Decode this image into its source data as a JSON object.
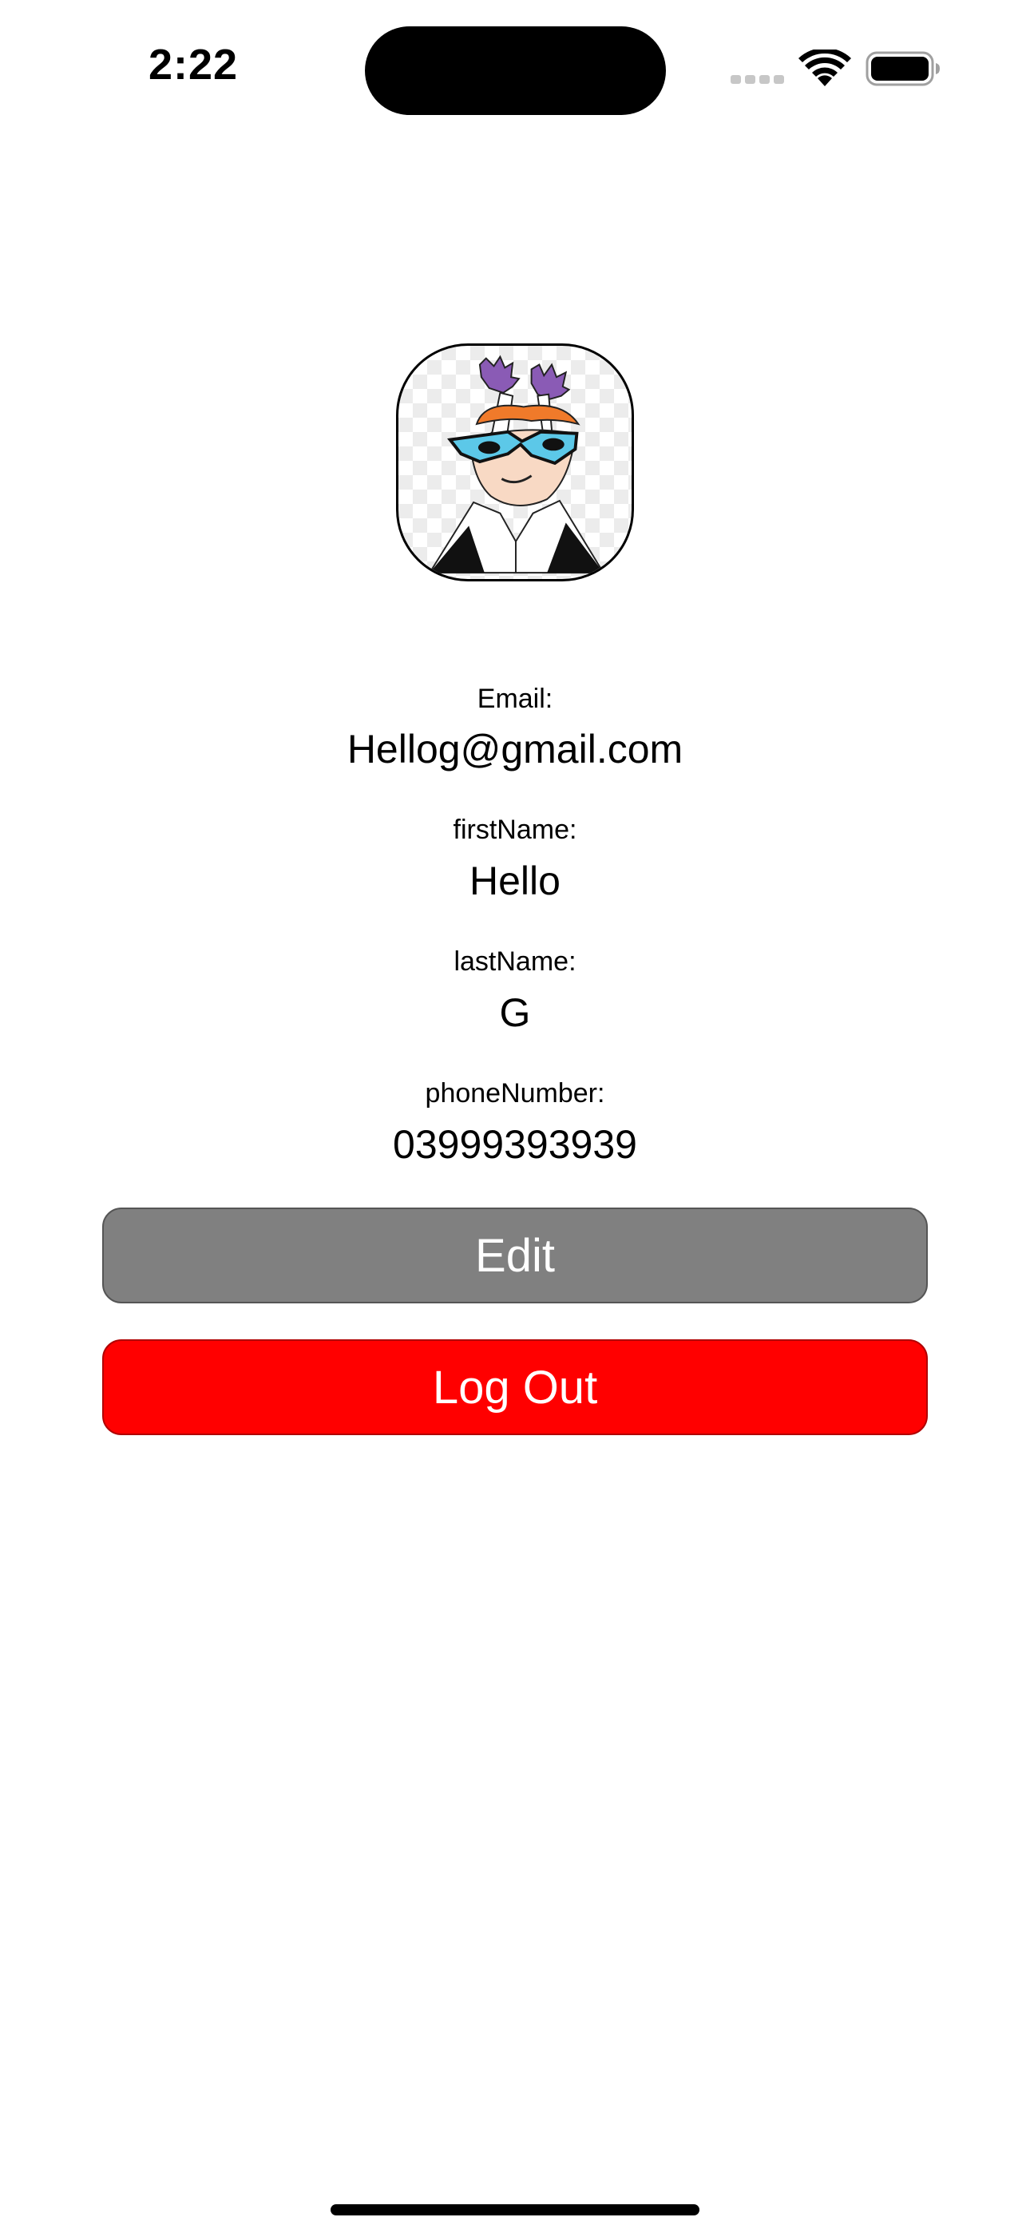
{
  "status_bar": {
    "time": "2:22",
    "icons": [
      "signal-icon",
      "wifi-icon",
      "battery-icon"
    ]
  },
  "profile": {
    "avatar": "dexter-avatar",
    "fields": [
      {
        "label": "Email:",
        "value": "Hellog@gmail.com"
      },
      {
        "label": "firstName:",
        "value": "Hello"
      },
      {
        "label": "lastName:",
        "value": "G"
      },
      {
        "label": "phoneNumber:",
        "value": "03999393939"
      }
    ]
  },
  "buttons": {
    "edit_label": "Edit",
    "edit_color": "#808080",
    "logout_label": "Log Out",
    "logout_color": "#ff0000"
  }
}
